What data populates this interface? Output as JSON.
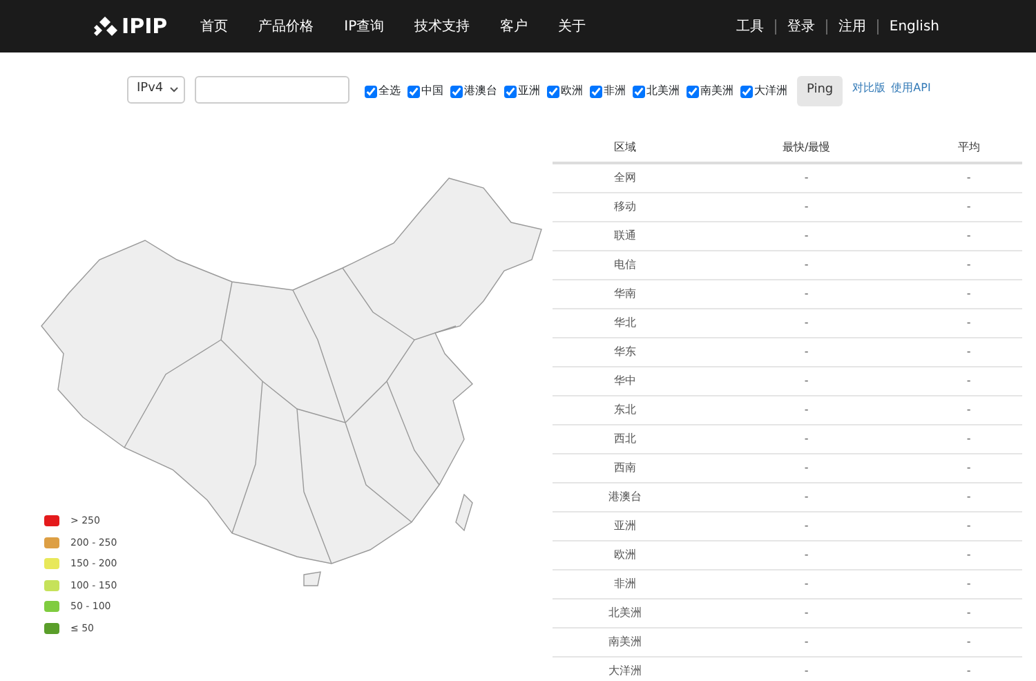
{
  "navbar": {
    "brand": "IPIP",
    "links": [
      "首页",
      "产品价格",
      "IP查询",
      "技术支持",
      "客户",
      "关于"
    ],
    "right_links": [
      "工具",
      "登录",
      "注用",
      "English"
    ]
  },
  "toolbar": {
    "protocol": "IPv4",
    "regions": [
      {
        "label": "全选",
        "checked": true
      },
      {
        "label": "中国",
        "checked": true
      },
      {
        "label": "港澳台",
        "checked": true
      },
      {
        "label": "亚洲",
        "checked": true
      },
      {
        "label": "欧洲",
        "checked": true
      },
      {
        "label": "非洲",
        "checked": true
      },
      {
        "label": "北美洲",
        "checked": true
      },
      {
        "label": "南美洲",
        "checked": true
      },
      {
        "label": "大洋洲",
        "checked": true
      }
    ],
    "button": "Ping",
    "links": [
      "对比版",
      "使用API"
    ]
  },
  "legend": [
    {
      "label": "> 250",
      "color": "#e41a1c"
    },
    {
      "label": "200 - 250",
      "color": "#dd9f44"
    },
    {
      "label": "150 - 200",
      "color": "#e8e85a"
    },
    {
      "label": "100 - 150",
      "color": "#c6e25a"
    },
    {
      "label": "50 - 100",
      "color": "#7fcc3f"
    },
    {
      "label": "≤ 50",
      "color": "#5a9e2a"
    }
  ],
  "table": {
    "columns": [
      "区域",
      "最快/最慢",
      "平均"
    ],
    "rows": [
      [
        "全网",
        "-",
        "-"
      ],
      [
        "移动",
        "-",
        "-"
      ],
      [
        "联通",
        "-",
        "-"
      ],
      [
        "电信",
        "-",
        "-"
      ],
      [
        "华南",
        "-",
        "-"
      ],
      [
        "华北",
        "-",
        "-"
      ],
      [
        "华东",
        "-",
        "-"
      ],
      [
        "华中",
        "-",
        "-"
      ],
      [
        "东北",
        "-",
        "-"
      ],
      [
        "西北",
        "-",
        "-"
      ],
      [
        "西南",
        "-",
        "-"
      ],
      [
        "港澳台",
        "-",
        "-"
      ],
      [
        "亚洲",
        "-",
        "-"
      ],
      [
        "欧洲",
        "-",
        "-"
      ],
      [
        "非洲",
        "-",
        "-"
      ],
      [
        "北美洲",
        "-",
        "-"
      ],
      [
        "南美洲",
        "-",
        "-"
      ],
      [
        "大洋洲",
        "-",
        "-"
      ]
    ]
  }
}
